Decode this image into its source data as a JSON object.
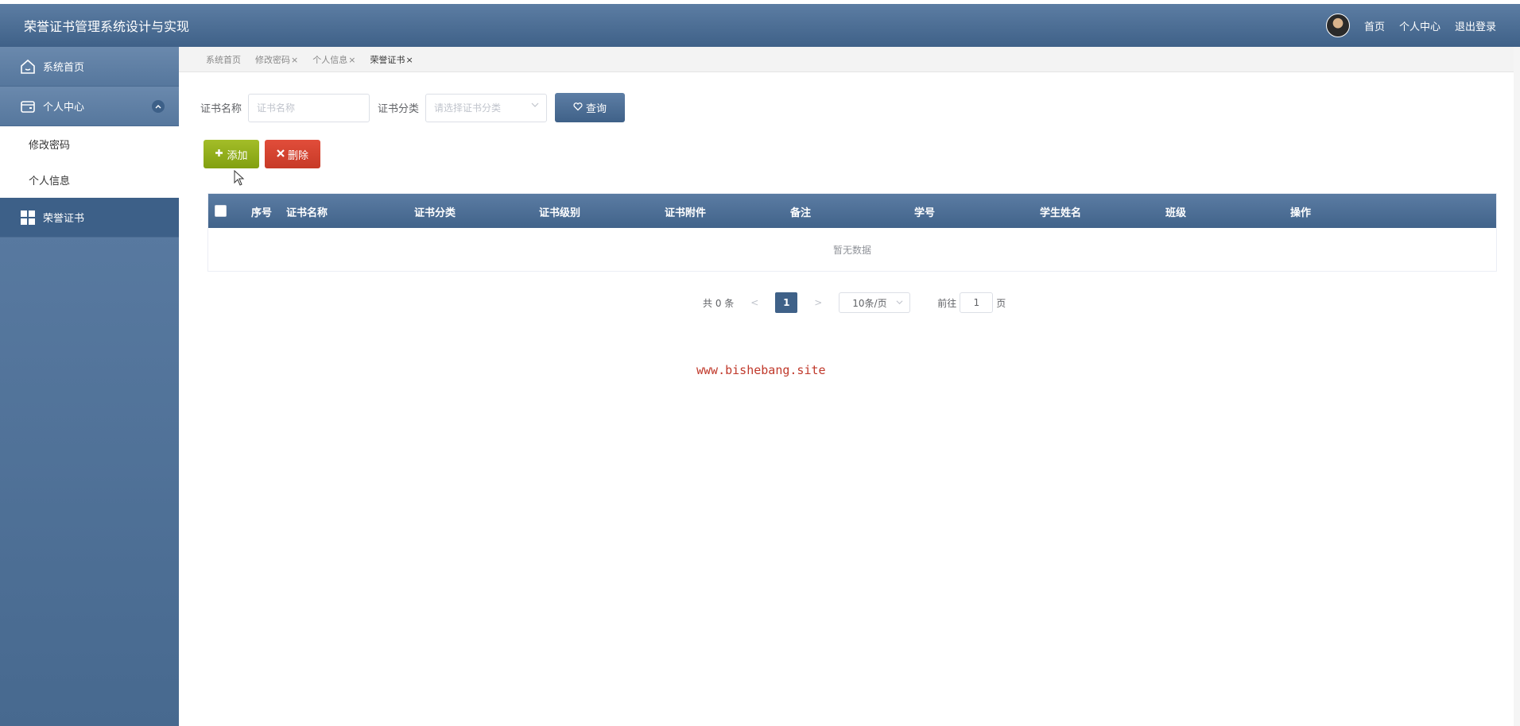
{
  "header": {
    "title": "荣誉证书管理系统设计与实现",
    "links": {
      "home": "首页",
      "profile": "个人中心",
      "logout": "退出登录"
    }
  },
  "sidebar": {
    "items": [
      {
        "label": "系统首页",
        "icon": "home-icon"
      },
      {
        "label": "个人中心",
        "icon": "wallet-icon",
        "expanded": true,
        "children": [
          {
            "label": "修改密码"
          },
          {
            "label": "个人信息"
          }
        ]
      },
      {
        "label": "荣誉证书",
        "icon": "grid-icon",
        "active": true
      }
    ]
  },
  "tags": [
    {
      "label": "系统首页",
      "closable": false
    },
    {
      "label": "修改密码",
      "closable": true
    },
    {
      "label": "个人信息",
      "closable": true
    },
    {
      "label": "荣誉证书",
      "closable": true,
      "active": true
    }
  ],
  "tag_close": "×",
  "search": {
    "name_label": "证书名称",
    "name_placeholder": "证书名称",
    "category_label": "证书分类",
    "category_placeholder": "请选择证书分类",
    "query_button": "查询"
  },
  "actions": {
    "add": "添加",
    "delete": "删除"
  },
  "table": {
    "columns": [
      "序号",
      "证书名称",
      "证书分类",
      "证书级别",
      "证书附件",
      "备注",
      "学号",
      "学生姓名",
      "班级",
      "操作"
    ],
    "empty_text": "暂无数据"
  },
  "pagination": {
    "total_text": "共 0 条",
    "prev": "<",
    "next": ">",
    "current_page": "1",
    "page_size": "10条/页",
    "goto_prefix": "前往",
    "goto_value": "1",
    "goto_suffix": "页"
  },
  "watermark": "www.bishebang.site",
  "colors": {
    "primary": "#3f6188",
    "add_button": "#8fac18",
    "delete_button": "#d4432f",
    "watermark": "#c0392b"
  }
}
